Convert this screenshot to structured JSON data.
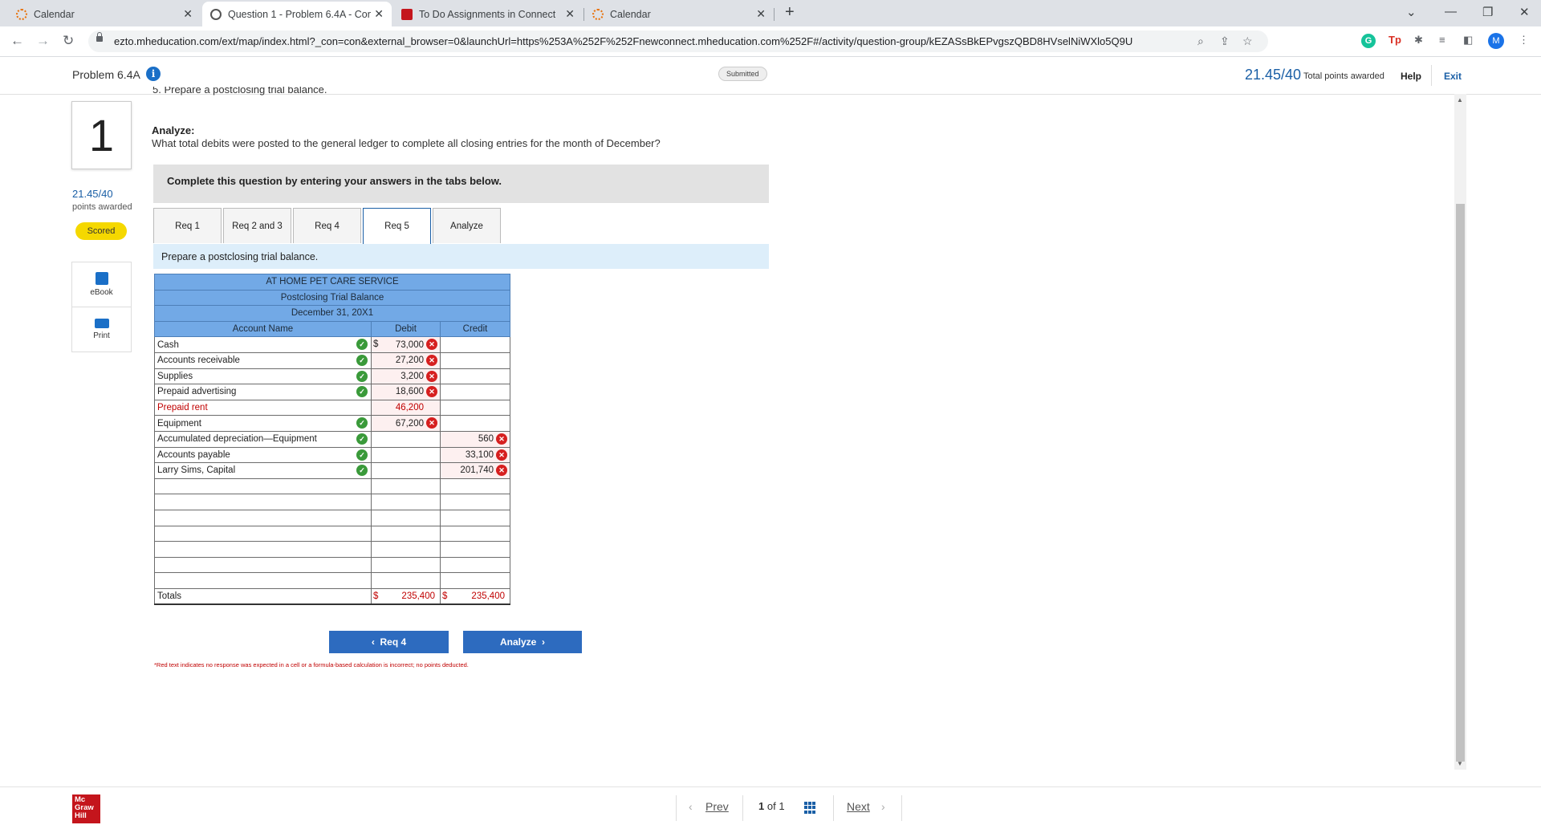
{
  "browser": {
    "tabs": [
      {
        "title": "Calendar",
        "icon": "calendar-icon",
        "active": false
      },
      {
        "title": "Question 1 - Problem 6.4A - Con",
        "icon": "question-icon",
        "active": true
      },
      {
        "title": "To Do Assignments in Connect",
        "icon": "mcgraw-hill-icon",
        "active": false
      },
      {
        "title": "Calendar",
        "icon": "calendar-icon",
        "active": false
      }
    ],
    "url": "ezto.mheducation.com/ext/map/index.html?_con=con&external_browser=0&launchUrl=https%253A%252F%252Fnewconnect.mheducation.com%252F#/activity/question-group/kEZASsBkEPvgszQBD8HVselNiWXlo5Q9UDNEBDWe0...",
    "profile_initial": "M"
  },
  "header": {
    "problem_title": "Problem 6.4A",
    "status": "Submitted",
    "points": "21.45/40",
    "points_label": "Total points awarded",
    "help": "Help",
    "exit": "Exit"
  },
  "left": {
    "question_number": "1",
    "points": "21.45/40",
    "points_label": "points awarded",
    "badge": "Scored",
    "ebook": "eBook",
    "print": "Print"
  },
  "content": {
    "cutoff_text": "5. Prepare a postclosing trial balance.",
    "analyze_heading": "Analyze:",
    "analyze_question": "What total debits were posted to the general ledger to complete all closing entries for the month of December?",
    "instructions": "Complete this question by entering your answers in the tabs below.",
    "tabs": [
      "Req 1",
      "Req 2 and 3",
      "Req 4",
      "Req 5",
      "Analyze"
    ],
    "selected_tab": "Req 5",
    "req_prompt": "Prepare a postclosing trial balance."
  },
  "trial_balance": {
    "company": "AT HOME PET CARE SERVICE",
    "title": "Postclosing Trial Balance",
    "date": "December 31, 20X1",
    "col_account": "Account Name",
    "col_debit": "Debit",
    "col_credit": "Credit",
    "currency": "$",
    "rows": [
      {
        "account": "Cash",
        "debit": "73,000",
        "credit": ""
      },
      {
        "account": "Accounts receivable",
        "debit": "27,200",
        "credit": ""
      },
      {
        "account": "Supplies",
        "debit": "3,200",
        "credit": ""
      },
      {
        "account": "Prepaid advertising",
        "debit": "18,600",
        "credit": ""
      },
      {
        "account": "Prepaid rent",
        "debit": "46,200",
        "credit": ""
      },
      {
        "account": "Equipment",
        "debit": "67,200",
        "credit": ""
      },
      {
        "account": "Accumulated depreciation—Equipment",
        "debit": "",
        "credit": "560"
      },
      {
        "account": "Accounts payable",
        "debit": "",
        "credit": "33,100"
      },
      {
        "account": "Larry Sims, Capital",
        "debit": "",
        "credit": "201,740"
      }
    ],
    "totals_label": "Totals",
    "total_debit": "235,400",
    "total_credit": "235,400"
  },
  "buttons": {
    "prev": "Req 4",
    "next": "Analyze"
  },
  "footnote": "*Red text indicates no response was expected in a cell or a formula-based calculation is incorrect; no points deducted.",
  "footer": {
    "logo_lines": [
      "Mc",
      "Graw",
      "Hill"
    ],
    "prev": "Prev",
    "page_current": "1",
    "page_of": "of",
    "page_total": "1",
    "next": "Next"
  }
}
